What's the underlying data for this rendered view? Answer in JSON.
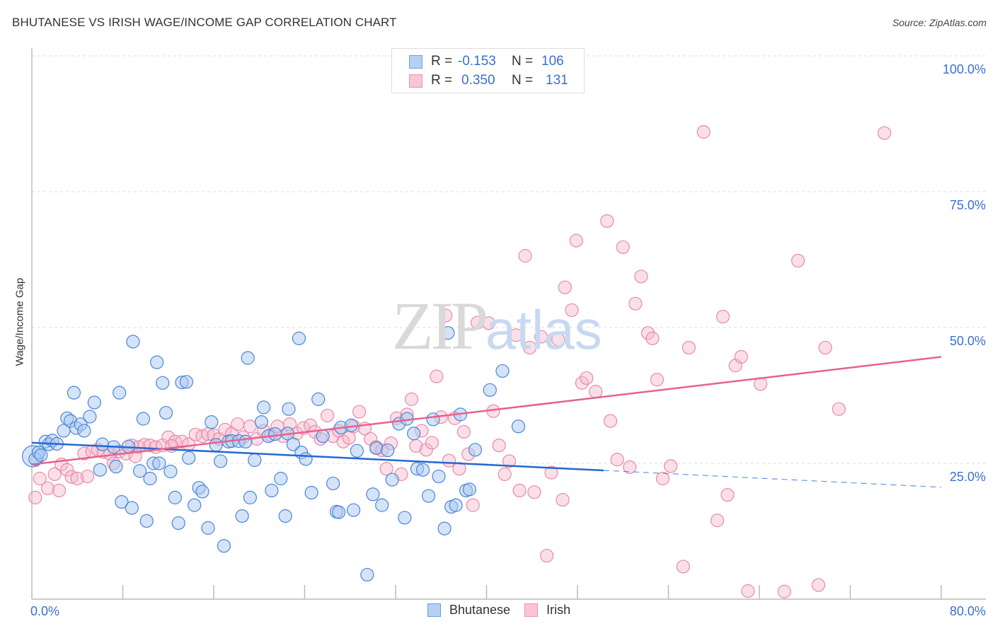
{
  "header": {
    "title": "BHUTANESE VS IRISH WAGE/INCOME GAP CORRELATION CHART",
    "source": "Source: ZipAtlas.com"
  },
  "watermark": {
    "zip": "ZIP",
    "atlas": "atlas"
  },
  "legend": {
    "rows": [
      {
        "r_label": "R =",
        "r_value": "-0.153",
        "n_label": "N =",
        "n_value": "106"
      },
      {
        "r_label": "R =",
        "r_value": "0.350",
        "n_label": "N =",
        "n_value": "131"
      }
    ],
    "bottom": [
      "Bhutanese",
      "Irish"
    ]
  },
  "colors": {
    "bhutanese_fill": "#a9c8f0",
    "bhutanese_stroke": "#4a86d8",
    "bhutanese_line": "#2468d0",
    "irish_fill": "#f7b8cc",
    "irish_stroke": "#e68aa8",
    "irish_line": "#e8628c",
    "tick_label": "#3a6fcf"
  },
  "chart_data": {
    "type": "scatter",
    "title": "BHUTANESE VS IRISH WAGE/INCOME GAP CORRELATION CHART",
    "xlabel": "",
    "ylabel": "Wage/Income Gap",
    "xlim": [
      0,
      80
    ],
    "ylim": [
      0,
      100
    ],
    "x_tick_labels": [
      "0.0%",
      "80.0%"
    ],
    "y_ticks": [
      25,
      50,
      75,
      100
    ],
    "y_tick_labels": [
      "25.0%",
      "50.0%",
      "75.0%",
      "100.0%"
    ],
    "grid": "horizontal-dashed",
    "legend_position": "top-center",
    "series": [
      {
        "name": "Bhutanese",
        "R": -0.153,
        "N": 106,
        "trend": {
          "x_start": 0,
          "y_start": 28.8,
          "x_end": 50.3,
          "y_end": 23.7,
          "dashed_to_x": 80,
          "dashed_end_y": 20.6
        },
        "points": [
          [
            0.1,
            26.3
          ],
          [
            0.3,
            25.8
          ],
          [
            0.6,
            27.0
          ],
          [
            0.8,
            26.5
          ],
          [
            1.2,
            29.0
          ],
          [
            1.5,
            28.5
          ],
          [
            1.8,
            29.2
          ],
          [
            2.2,
            28.6
          ],
          [
            2.8,
            31.0
          ],
          [
            3.1,
            33.3
          ],
          [
            3.4,
            32.8
          ],
          [
            3.9,
            31.5
          ],
          [
            4.3,
            32.2
          ],
          [
            4.6,
            31.0
          ],
          [
            5.1,
            33.6
          ],
          [
            5.5,
            36.2
          ],
          [
            3.7,
            38.0
          ],
          [
            6.0,
            23.8
          ],
          [
            6.2,
            28.5
          ],
          [
            7.2,
            28.0
          ],
          [
            7.4,
            24.4
          ],
          [
            7.7,
            38.0
          ],
          [
            7.9,
            17.9
          ],
          [
            8.5,
            28.1
          ],
          [
            8.8,
            16.8
          ],
          [
            8.9,
            47.4
          ],
          [
            9.5,
            23.6
          ],
          [
            9.8,
            33.2
          ],
          [
            10.1,
            14.4
          ],
          [
            10.4,
            22.2
          ],
          [
            10.7,
            25.0
          ],
          [
            11.0,
            43.6
          ],
          [
            11.2,
            25.0
          ],
          [
            11.5,
            39.8
          ],
          [
            11.8,
            34.3
          ],
          [
            12.2,
            23.5
          ],
          [
            12.6,
            18.7
          ],
          [
            12.9,
            14.0
          ],
          [
            13.2,
            39.9
          ],
          [
            13.6,
            40.0
          ],
          [
            13.8,
            26.0
          ],
          [
            14.3,
            17.3
          ],
          [
            14.7,
            20.5
          ],
          [
            15.0,
            19.8
          ],
          [
            15.5,
            13.1
          ],
          [
            15.8,
            32.6
          ],
          [
            16.2,
            28.4
          ],
          [
            16.6,
            25.4
          ],
          [
            16.9,
            9.8
          ],
          [
            17.3,
            29.0
          ],
          [
            17.6,
            29.1
          ],
          [
            18.2,
            29.1
          ],
          [
            18.5,
            15.3
          ],
          [
            18.8,
            29.0
          ],
          [
            19.0,
            44.4
          ],
          [
            19.2,
            18.7
          ],
          [
            19.6,
            25.6
          ],
          [
            20.2,
            32.6
          ],
          [
            20.4,
            35.3
          ],
          [
            20.8,
            30.0
          ],
          [
            21.1,
            20.0
          ],
          [
            21.4,
            30.4
          ],
          [
            21.9,
            22.2
          ],
          [
            22.3,
            15.3
          ],
          [
            22.5,
            30.5
          ],
          [
            22.6,
            35.0
          ],
          [
            23.0,
            28.5
          ],
          [
            23.5,
            48.0
          ],
          [
            23.7,
            27.0
          ],
          [
            24.1,
            25.8
          ],
          [
            24.6,
            19.6
          ],
          [
            25.2,
            36.8
          ],
          [
            25.6,
            30.0
          ],
          [
            26.5,
            21.3
          ],
          [
            26.8,
            16.1
          ],
          [
            27.0,
            16.0
          ],
          [
            27.2,
            31.6
          ],
          [
            28.1,
            32.0
          ],
          [
            28.3,
            16.4
          ],
          [
            28.6,
            27.3
          ],
          [
            29.5,
            4.5
          ],
          [
            30.0,
            19.3
          ],
          [
            30.3,
            27.8
          ],
          [
            30.8,
            17.3
          ],
          [
            31.3,
            27.4
          ],
          [
            31.7,
            22.0
          ],
          [
            32.3,
            32.3
          ],
          [
            32.8,
            15.0
          ],
          [
            33.0,
            33.2
          ],
          [
            33.6,
            30.5
          ],
          [
            33.9,
            24.0
          ],
          [
            34.4,
            23.8
          ],
          [
            34.9,
            19.0
          ],
          [
            35.3,
            33.1
          ],
          [
            35.8,
            22.6
          ],
          [
            36.3,
            13.0
          ],
          [
            36.6,
            49.0
          ],
          [
            36.9,
            17.0
          ],
          [
            37.3,
            17.3
          ],
          [
            37.7,
            34.0
          ],
          [
            38.2,
            20.0
          ],
          [
            38.5,
            20.2
          ],
          [
            39.0,
            27.5
          ],
          [
            40.3,
            38.5
          ],
          [
            41.4,
            42.0
          ],
          [
            42.8,
            31.8
          ]
        ]
      },
      {
        "name": "Irish",
        "R": 0.35,
        "N": 131,
        "trend": {
          "x_start": 0,
          "y_start": 24.8,
          "x_end": 80,
          "y_end": 44.6
        },
        "points": [
          [
            0.3,
            18.7
          ],
          [
            0.7,
            22.2
          ],
          [
            1.4,
            20.4
          ],
          [
            2.0,
            23.0
          ],
          [
            2.6,
            24.8
          ],
          [
            3.1,
            23.8
          ],
          [
            3.5,
            22.5
          ],
          [
            4.0,
            22.2
          ],
          [
            4.6,
            26.8
          ],
          [
            5.3,
            27.2
          ],
          [
            5.8,
            27.5
          ],
          [
            6.3,
            27.1
          ],
          [
            6.9,
            26.7
          ],
          [
            7.2,
            25.0
          ],
          [
            7.7,
            27.2
          ],
          [
            8.3,
            26.8
          ],
          [
            8.8,
            28.3
          ],
          [
            9.4,
            28.0
          ],
          [
            9.9,
            28.4
          ],
          [
            10.4,
            28.3
          ],
          [
            10.9,
            28.0
          ],
          [
            11.5,
            28.3
          ],
          [
            12.0,
            29.8
          ],
          [
            12.6,
            29.0
          ],
          [
            13.2,
            29.0
          ],
          [
            13.8,
            28.5
          ],
          [
            14.4,
            30.3
          ],
          [
            15.0,
            30.0
          ],
          [
            15.5,
            30.4
          ],
          [
            16.0,
            30.2
          ],
          [
            16.5,
            29.5
          ],
          [
            17.0,
            31.2
          ],
          [
            17.6,
            30.5
          ],
          [
            18.1,
            32.2
          ],
          [
            18.6,
            29.8
          ],
          [
            19.2,
            31.8
          ],
          [
            19.8,
            29.5
          ],
          [
            20.4,
            31.0
          ],
          [
            21.0,
            30.2
          ],
          [
            21.6,
            31.8
          ],
          [
            22.1,
            30.0
          ],
          [
            22.7,
            32.2
          ],
          [
            23.3,
            30.5
          ],
          [
            23.9,
            31.5
          ],
          [
            24.5,
            32.0
          ],
          [
            24.9,
            30.8
          ],
          [
            25.4,
            29.5
          ],
          [
            26.0,
            33.8
          ],
          [
            26.5,
            30.0
          ],
          [
            27.0,
            31.0
          ],
          [
            27.4,
            29.0
          ],
          [
            27.9,
            29.7
          ],
          [
            28.3,
            31.8
          ],
          [
            28.8,
            34.5
          ],
          [
            29.3,
            31.4
          ],
          [
            29.8,
            29.5
          ],
          [
            30.3,
            28.0
          ],
          [
            30.8,
            27.4
          ],
          [
            31.2,
            24.0
          ],
          [
            31.6,
            28.7
          ],
          [
            32.1,
            33.3
          ],
          [
            32.5,
            23.0
          ],
          [
            33.0,
            34.0
          ],
          [
            33.4,
            36.8
          ],
          [
            33.8,
            28.2
          ],
          [
            34.3,
            31.0
          ],
          [
            34.7,
            27.5
          ],
          [
            35.2,
            28.8
          ],
          [
            35.6,
            41.0
          ],
          [
            36.0,
            33.5
          ],
          [
            36.4,
            52.2
          ],
          [
            36.7,
            25.5
          ],
          [
            37.2,
            33.3
          ],
          [
            37.6,
            24.0
          ],
          [
            38.0,
            30.8
          ],
          [
            38.4,
            26.7
          ],
          [
            38.8,
            17.3
          ],
          [
            39.2,
            50.9
          ],
          [
            40.2,
            50.8
          ],
          [
            40.6,
            34.6
          ],
          [
            41.1,
            28.3
          ],
          [
            41.6,
            23.0
          ],
          [
            42.0,
            25.4
          ],
          [
            42.6,
            48.6
          ],
          [
            42.9,
            20.0
          ],
          [
            43.4,
            63.2
          ],
          [
            43.8,
            46.3
          ],
          [
            44.2,
            19.7
          ],
          [
            44.8,
            48.3
          ],
          [
            45.3,
            8.0
          ],
          [
            45.7,
            23.3
          ],
          [
            46.3,
            47.8
          ],
          [
            46.7,
            18.3
          ],
          [
            46.9,
            57.4
          ],
          [
            47.5,
            53.2
          ],
          [
            47.9,
            66.0
          ],
          [
            48.4,
            39.8
          ],
          [
            48.8,
            40.7
          ],
          [
            49.6,
            38.2
          ],
          [
            50.6,
            69.6
          ],
          [
            50.9,
            32.8
          ],
          [
            51.5,
            25.7
          ],
          [
            52.0,
            64.8
          ],
          [
            52.6,
            24.3
          ],
          [
            53.1,
            54.4
          ],
          [
            53.6,
            59.4
          ],
          [
            54.2,
            49.0
          ],
          [
            54.6,
            48.0
          ],
          [
            55.0,
            40.4
          ],
          [
            55.5,
            22.2
          ],
          [
            56.2,
            24.5
          ],
          [
            57.3,
            6.0
          ],
          [
            57.8,
            46.3
          ],
          [
            59.1,
            86.0
          ],
          [
            60.3,
            14.5
          ],
          [
            60.8,
            52.0
          ],
          [
            61.2,
            19.2
          ],
          [
            61.9,
            43.0
          ],
          [
            62.4,
            44.6
          ],
          [
            63.0,
            1.5
          ],
          [
            64.1,
            39.6
          ],
          [
            66.2,
            1.4
          ],
          [
            67.4,
            62.3
          ],
          [
            69.2,
            2.6
          ],
          [
            69.8,
            46.3
          ],
          [
            71.0,
            35.0
          ],
          [
            75.0,
            85.8
          ],
          [
            2.4,
            20.0
          ],
          [
            4.9,
            22.6
          ],
          [
            9.1,
            26.3
          ],
          [
            12.3,
            28.2
          ]
        ]
      }
    ]
  }
}
